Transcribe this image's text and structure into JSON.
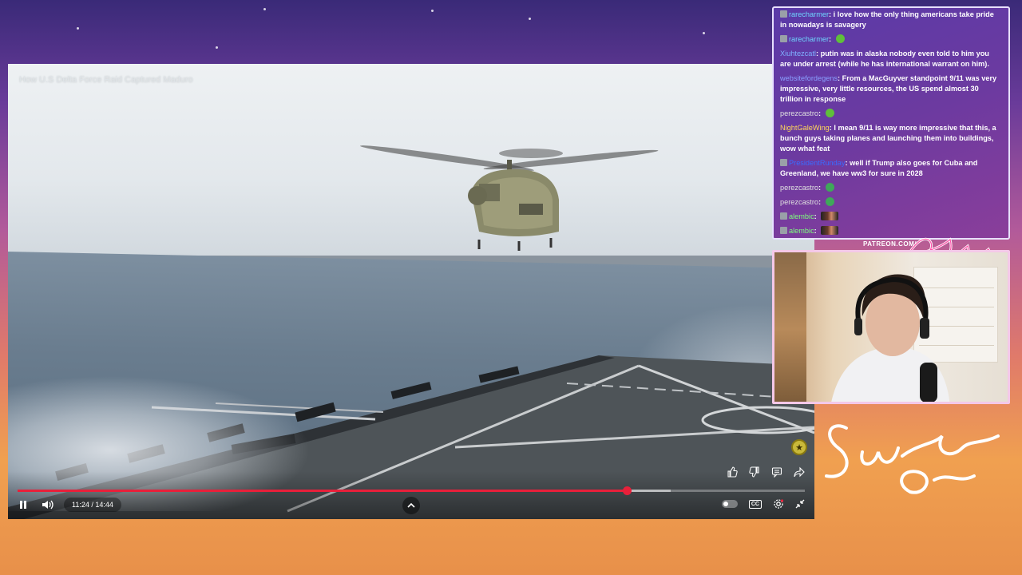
{
  "video": {
    "title": "How U.S Delta Force Raid Captured Maduro",
    "current_time": "11:24",
    "duration": "14:44",
    "time_display": "11:24 / 14:44",
    "progress_fraction": 0.7735,
    "buffer_fraction": 0.83
  },
  "chat": {
    "messages": [
      {
        "user": "rarecharmer",
        "text": "i love how the only thing americans take pride in nowadays is savagery",
        "user_color": "#6fd7ff",
        "badge": true
      },
      {
        "user": "rarecharmer",
        "text": "",
        "user_color": "#6fd7ff",
        "badge": true,
        "emote": "green"
      },
      {
        "user": "Xiuhtezcatl",
        "text": "putin was in alaska nobody even told to him you are under arrest (while he has international warrant on him).",
        "user_color": "#7fb0ff",
        "badge": false
      },
      {
        "user": "websitefordegens",
        "text": "From a MacGuyver standpoint 9/11 was very impressive, very little resources, the US spend almost 30 trillion in response",
        "user_color": "#8aa0ff",
        "badge": false
      },
      {
        "user": "perezcastro",
        "text": "",
        "user_color": "#e0e0e0",
        "badge": false,
        "emote": "green"
      },
      {
        "user": "NightGaleWing",
        "text": "I mean 9/11 is way more impressive that this, a bunch guys taking planes and launching them into buildings, wow what feat",
        "user_color": "#ffd75a",
        "badge": false
      },
      {
        "user": "PresidentRunday",
        "text": "well if Trump also goes for Cuba and Greenland, we have ww3 for sure in 2028",
        "user_color": "#3a6bff",
        "badge": true
      },
      {
        "user": "perezcastro",
        "text": "",
        "user_color": "#e0e0e0",
        "badge": false,
        "emote": "green-sphere"
      },
      {
        "user": "perezcastro",
        "text": "",
        "user_color": "#e0e0e0",
        "badge": false,
        "emote": "green-sphere"
      },
      {
        "user": "alembic",
        "text": "",
        "user_color": "#7dff7d",
        "badge": true,
        "emote": "image"
      },
      {
        "user": "alembic",
        "text": "",
        "user_color": "#7dff7d",
        "badge": true,
        "emote": "image"
      }
    ]
  },
  "overlay": {
    "patreon": "PATREON.COM/"
  },
  "colors": {
    "progress": "#e8203a",
    "chat_bg": "#5a3aa8",
    "cam_border": "#f4c8e8"
  },
  "icons": {
    "play_pause": "pause-icon",
    "volume": "volume-icon",
    "expand": "chevron-up-icon",
    "like": "thumbs-up-icon",
    "dislike": "thumbs-down-icon",
    "comments": "comment-icon",
    "share": "share-icon",
    "settings": "gear-icon",
    "captions": "cc-icon",
    "exit_fullscreen": "exit-fullscreen-icon"
  }
}
